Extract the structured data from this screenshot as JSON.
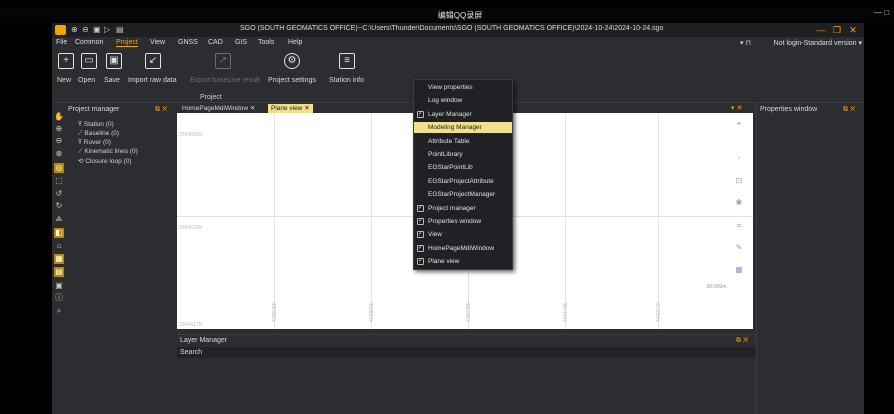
{
  "recorder": {
    "label": "编辑QQ录屏",
    "controls": "— □"
  },
  "window": {
    "title": "SGO (SOUTH GEOMATICS OFFICE)--C:\\Users\\Thunder\\Documents\\SGO (SOUTH GEOMATICS OFFICE)\\2024-10-24\\2024-10-24.sgo",
    "logo_text": "SGO",
    "minimize": "—",
    "restore": "❐",
    "close": "✕"
  },
  "menu": {
    "items": [
      "File",
      "Common",
      "Project",
      "View",
      "GNSS",
      "CAD",
      "GIS",
      "Tools",
      "Help"
    ],
    "active": "Project",
    "login": "Not login-Standard version ▾"
  },
  "ribbon": {
    "buttons": [
      {
        "label": "New",
        "icon": "new-icon",
        "glyph": "+",
        "enabled": true
      },
      {
        "label": "Open",
        "icon": "open-folder-icon",
        "glyph": "▭",
        "enabled": true
      },
      {
        "label": "Save",
        "icon": "save-icon",
        "glyph": "▣",
        "enabled": true
      },
      {
        "label": "Import raw data",
        "icon": "import-icon",
        "glyph": "↙",
        "enabled": true
      },
      {
        "label": "Export baseLine result",
        "icon": "export-icon",
        "glyph": "↗",
        "enabled": false
      },
      {
        "label": "Project settings",
        "icon": "gear-icon",
        "glyph": "⚙",
        "enabled": true
      },
      {
        "label": "Station info",
        "icon": "document-icon",
        "glyph": "≡",
        "enabled": true
      }
    ],
    "group_label": "Project"
  },
  "project_manager": {
    "title": "Project manager",
    "controls": "⧉ ✕",
    "items": [
      {
        "glyph": "Ŧ",
        "label": "Station (0)"
      },
      {
        "glyph": "⟋",
        "label": "Baseline (0)"
      },
      {
        "glyph": "Ŧ",
        "label": "Rover (0)"
      },
      {
        "glyph": "⟋",
        "label": "Kinematic lines (0)"
      },
      {
        "glyph": "⟲",
        "label": "Closure loop (0)"
      }
    ]
  },
  "tabs": [
    {
      "label": "HomePageMdiWindow ✕",
      "active": false
    },
    {
      "label": "Plane view ✕",
      "active": true
    }
  ],
  "plane_view": {
    "y_labels": [
      "2504835N",
      "2504626N",
      "2504417N"
    ],
    "x_labels": [
      "439568E",
      "439882E",
      "439978E",
      "440148E",
      "440224E"
    ],
    "scale": "80.000m"
  },
  "properties_window": {
    "title": "Properties window",
    "controls": "⧉ ✕"
  },
  "layer_manager": {
    "title": "Layer Manager",
    "controls": "⧉ ✕",
    "search_label": "Search"
  },
  "context_menu": [
    {
      "label": "View properties",
      "checked": false,
      "highlighted": false
    },
    {
      "label": "Log window",
      "checked": false,
      "highlighted": false
    },
    {
      "label": "Layer Manager",
      "checked": true,
      "highlighted": false
    },
    {
      "label": "Modeling Manager",
      "checked": false,
      "highlighted": true
    },
    {
      "label": "Attribute Table",
      "checked": false,
      "highlighted": false
    },
    {
      "label": "PointLibrary",
      "checked": false,
      "highlighted": false
    },
    {
      "label": "EGStarPointLib",
      "checked": false,
      "highlighted": false
    },
    {
      "label": "EGStarProjectAttribute",
      "checked": false,
      "highlighted": false
    },
    {
      "label": "EGStarProjectManager",
      "checked": false,
      "highlighted": false
    },
    {
      "label": "Project manager",
      "checked": true,
      "highlighted": false
    },
    {
      "label": "Properties window",
      "checked": true,
      "highlighted": false
    },
    {
      "label": "View",
      "checked": true,
      "highlighted": false
    },
    {
      "label": "HomePageMdiWindow",
      "checked": true,
      "highlighted": false
    },
    {
      "label": "Plane view",
      "checked": true,
      "highlighted": false
    }
  ],
  "colors": {
    "accent": "#f0a500",
    "highlight": "#f0e08a",
    "background": "#2b2d31"
  }
}
